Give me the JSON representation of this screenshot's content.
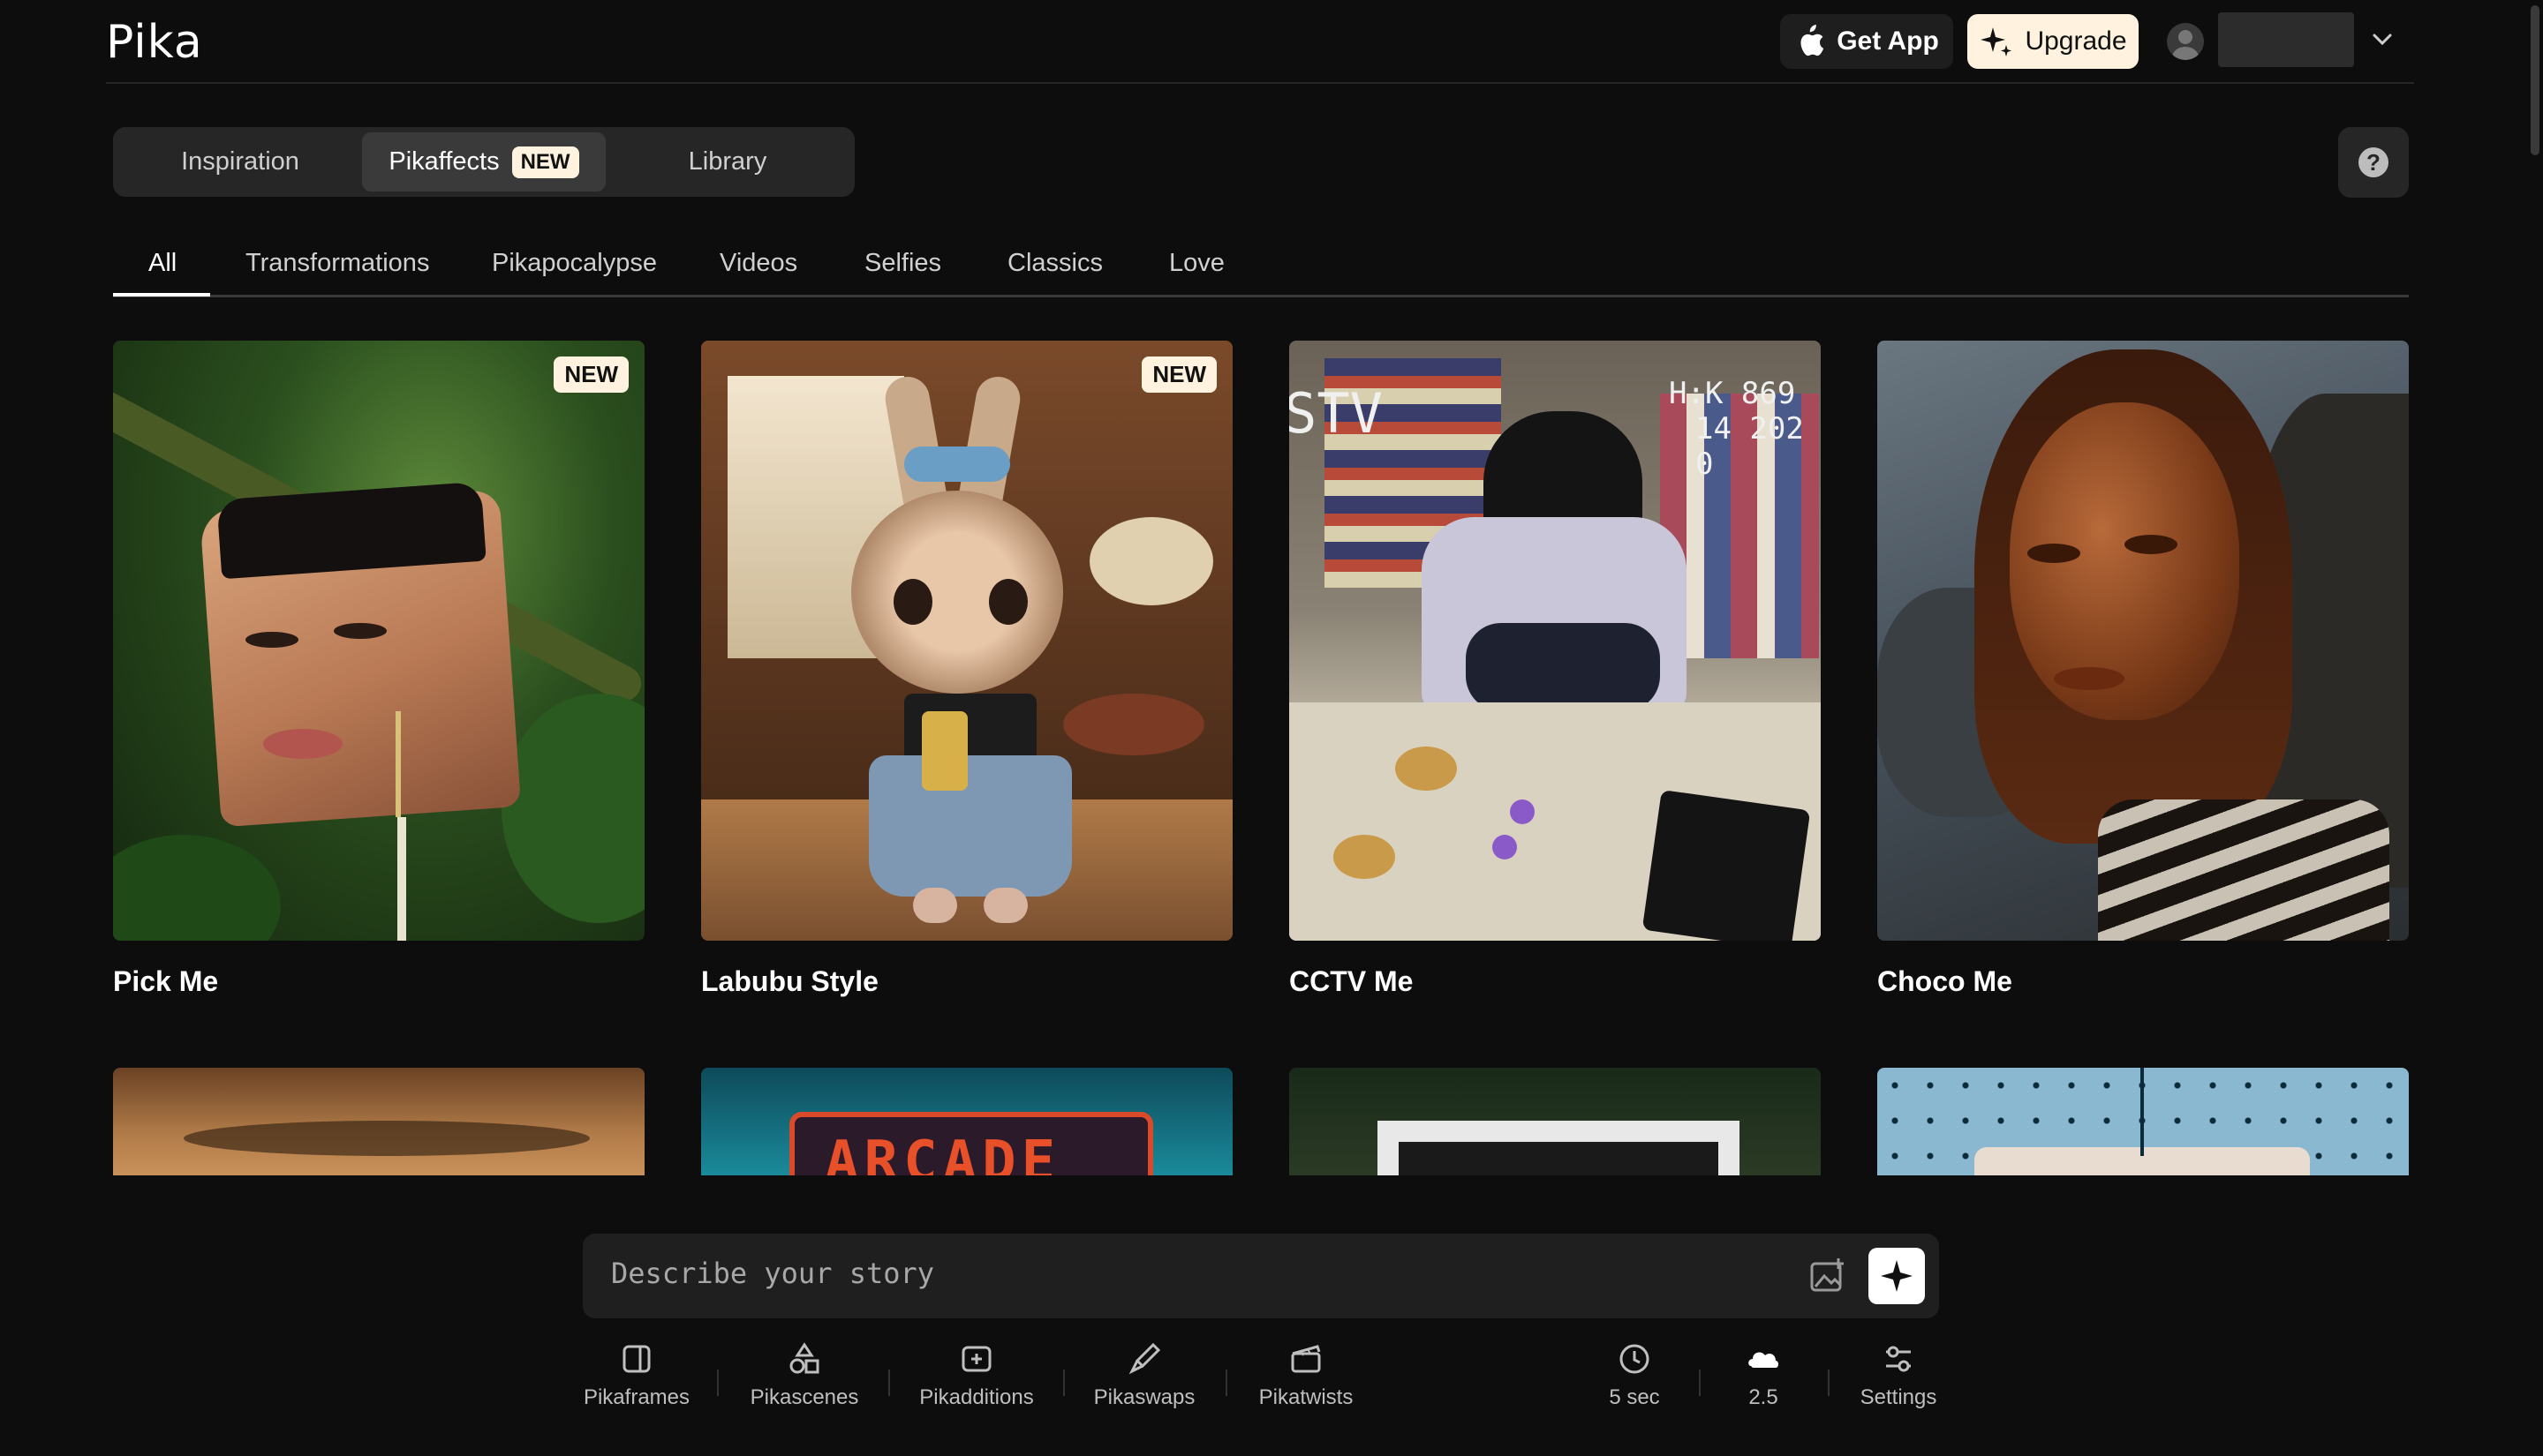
{
  "header": {
    "logo": "Pika",
    "get_app": "Get App",
    "upgrade": "Upgrade"
  },
  "main_tabs": [
    {
      "label": "Inspiration",
      "active": false
    },
    {
      "label": "Pikaffects",
      "active": true,
      "badge": "NEW"
    },
    {
      "label": "Library",
      "active": false
    }
  ],
  "categories": [
    {
      "label": "All",
      "active": true
    },
    {
      "label": "Transformations"
    },
    {
      "label": "Pikapocalypse"
    },
    {
      "label": "Videos"
    },
    {
      "label": "Selfies"
    },
    {
      "label": "Classics"
    },
    {
      "label": "Love"
    }
  ],
  "cards": [
    {
      "title": "Pick Me",
      "badge": "NEW"
    },
    {
      "title": "Labubu Style",
      "badge": "NEW"
    },
    {
      "title": "CCTV Me",
      "overlay_text": "STV",
      "overlay_code1": "H:K 869",
      "overlay_code2": "14 202 0"
    },
    {
      "title": "Choco Me"
    }
  ],
  "row2": {
    "arcade_sign": "ARCADE"
  },
  "prompt": {
    "placeholder": "Describe your story"
  },
  "tools": [
    {
      "label": "Pikaframes",
      "icon": "frames-icon"
    },
    {
      "label": "Pikascenes",
      "icon": "shapes-icon"
    },
    {
      "label": "Pikadditions",
      "icon": "add-frame-icon"
    },
    {
      "label": "Pikaswaps",
      "icon": "brush-icon"
    },
    {
      "label": "Pikatwists",
      "icon": "clapper-icon"
    }
  ],
  "settings": [
    {
      "label": "5 sec",
      "icon": "clock-icon"
    },
    {
      "label": "2.5",
      "icon": "cloud-icon"
    },
    {
      "label": "Settings",
      "icon": "sliders-icon"
    }
  ],
  "colors": {
    "accent_badge": "#fff3df",
    "background": "#0d0d0d",
    "panel": "#262626"
  }
}
